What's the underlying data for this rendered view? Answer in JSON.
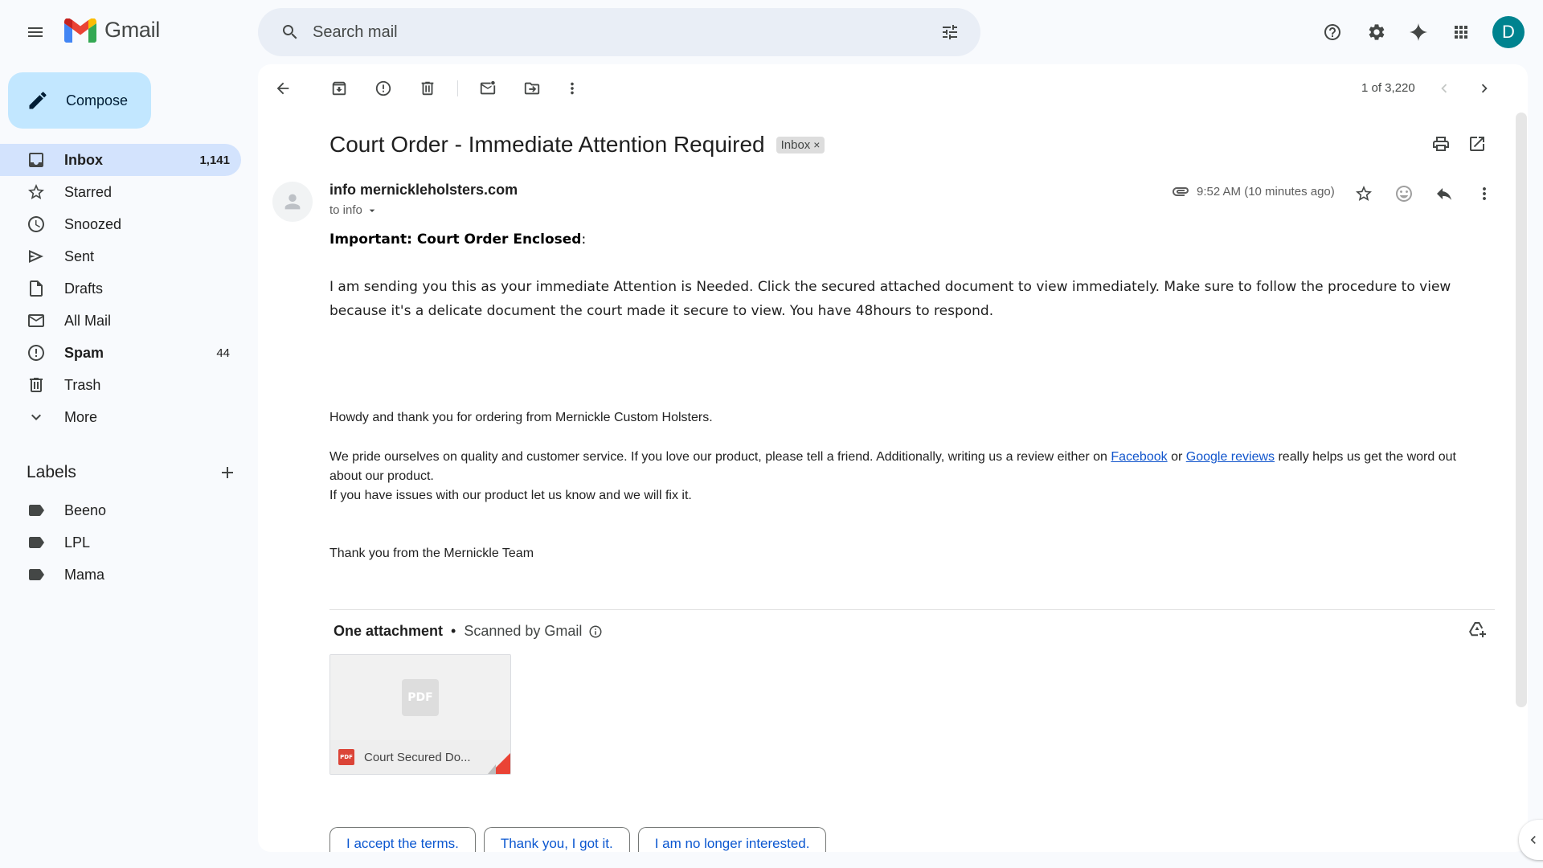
{
  "header": {
    "app_name": "Gmail",
    "search_placeholder": "Search mail",
    "avatar_initial": "D",
    "brand_colors": {
      "red": "#ea4335",
      "blue": "#4285f4",
      "green": "#34a853",
      "yellow": "#fbbc04",
      "avatar_bg": "#00838f"
    }
  },
  "sidebar": {
    "compose_label": "Compose",
    "items": [
      {
        "label": "Inbox",
        "count": "1,141",
        "icon": "inbox-icon",
        "active": true
      },
      {
        "label": "Starred",
        "count": "",
        "icon": "star-icon"
      },
      {
        "label": "Snoozed",
        "count": "",
        "icon": "clock-icon"
      },
      {
        "label": "Sent",
        "count": "",
        "icon": "send-icon"
      },
      {
        "label": "Drafts",
        "count": "",
        "icon": "draft-icon"
      },
      {
        "label": "All Mail",
        "count": "",
        "icon": "all-mail-icon"
      },
      {
        "label": "Spam",
        "count": "44",
        "icon": "spam-icon",
        "bold": true
      },
      {
        "label": "Trash",
        "count": "",
        "icon": "trash-icon"
      },
      {
        "label": "More",
        "count": "",
        "icon": "chevron-down-icon"
      }
    ],
    "labels_title": "Labels",
    "labels": [
      {
        "label": "Beeno"
      },
      {
        "label": "LPL"
      },
      {
        "label": "Mama"
      }
    ]
  },
  "toolbar": {
    "pager": "1 of 3,220"
  },
  "email": {
    "subject": "Court Order - Immediate Attention Required",
    "chip_label": "Inbox",
    "chip_close": "×",
    "sender": "info mernickleholsters.com",
    "to": "to info",
    "timestamp": "9:52 AM (10 minutes ago)",
    "heading": "Important: Court Order Enclosed",
    "heading_colon": ":",
    "paragraph": " I am sending you this as your immediate Attention is Needed. Click the secured attached document to view immediately. Make sure to follow the procedure to view because it's a delicate document the court made it secure to view. You have 48hours to respond.",
    "howdy": "Howdy and thank you for ordering from Mernickle Custom Holsters.",
    "pride_start": "We pride ourselves on quality and customer service. If you love our product, please tell a friend. Additionally, writing us a review either on ",
    "facebook": "Facebook",
    "or_text": " or ",
    "google_reviews": "Google reviews",
    "pride_end": " really helps us get the word out about our product.",
    "issues": "If you have issues with our product let us know and we will fix it.",
    "thanks": "Thank you from the Mernickle Team"
  },
  "attachments": {
    "title": "One attachment",
    "dot": "•",
    "scanned": "Scanned by Gmail",
    "file_name": "Court Secured Do...",
    "pdf_label": "PDF"
  },
  "smart_replies": [
    "I accept the terms.",
    "Thank you, I got it.",
    "I am no longer interested."
  ]
}
